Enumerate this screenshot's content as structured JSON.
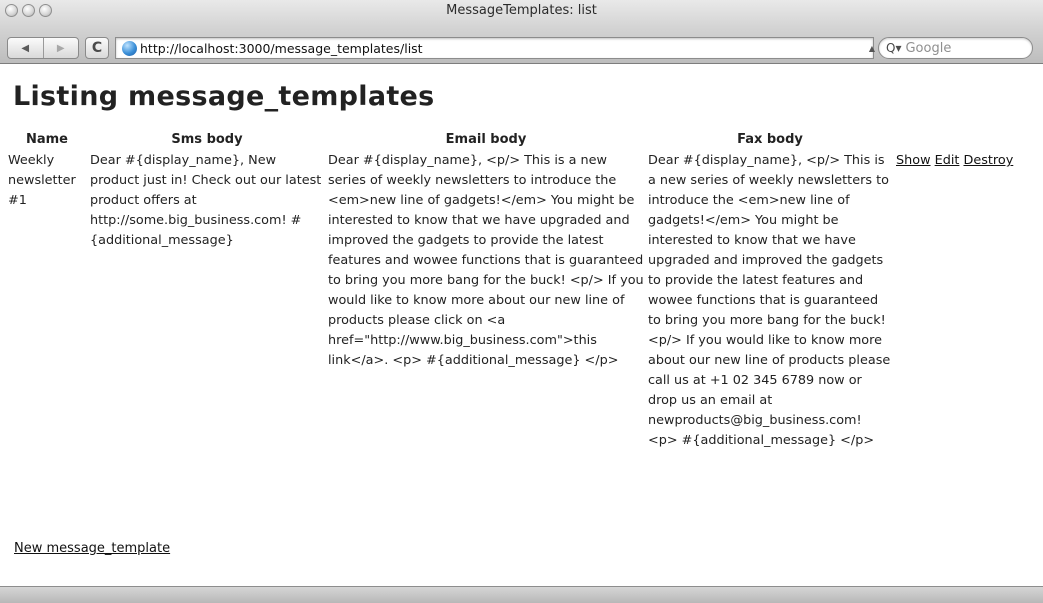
{
  "window": {
    "title": "MessageTemplates: list"
  },
  "toolbar": {
    "back_glyph": "◀",
    "forward_glyph": "▶",
    "reload_glyph": "C",
    "url": "http://localhost:3000/message_templates/list",
    "search_placeholder": "Google",
    "search_icon_glyph": "Q▾"
  },
  "page": {
    "title": "Listing message_templates",
    "columns": [
      "Name",
      "Sms body",
      "Email body",
      "Fax body"
    ],
    "rows": [
      {
        "name": "Weekly newsletter #1",
        "sms_body": "Dear #{display_name}, New product just in! Check out our latest product offers at http://some.big_business.com! #{additional_message}",
        "email_body": "Dear #{display_name}, <p/> This is a new series of weekly newsletters to introduce the <em>new line of gadgets!</em> You might be interested to know that we have upgraded and improved the gadgets to provide the latest features and wowee functions that is guaranteed to bring you more bang for the buck! <p/> If you would like to know more about our new line of products please click on <a href=\"http://www.big_business.com\">this link</a>. <p> #{additional_message} </p>",
        "fax_body": "Dear #{display_name}, <p/> This is a new series of weekly newsletters to introduce the <em>new line of gadgets!</em> You might be interested to know that we have upgraded and improved the gadgets to provide the latest features and wowee functions that is guaranteed to bring you more bang for the buck! <p/> If you would like to know more about our new line of products please call us at +1 02 345 6789 now or drop us an email at newproducts@big_business.com! <p> #{additional_message} </p>",
        "actions": {
          "show": "Show",
          "edit": "Edit",
          "destroy": "Destroy"
        }
      }
    ],
    "new_link": "New message_template"
  }
}
